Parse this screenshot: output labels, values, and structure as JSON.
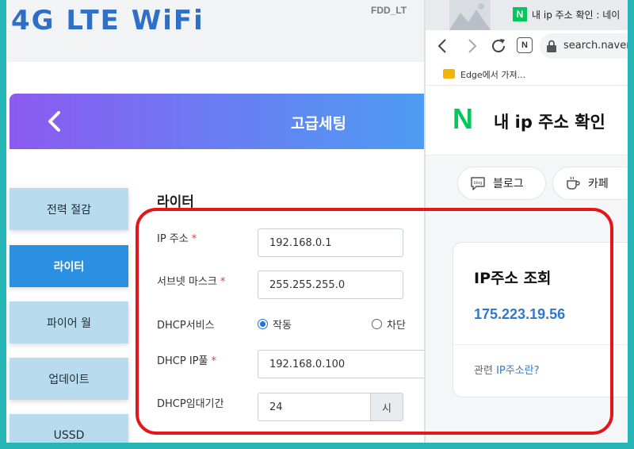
{
  "router": {
    "brand": "4G LTE WiFi",
    "model": "FDD_LT",
    "page_title": "고급세팅",
    "sidebar": {
      "items": [
        {
          "label": "전력 절감",
          "active": false
        },
        {
          "label": "라이터",
          "active": true
        },
        {
          "label": "파이어 월",
          "active": false
        },
        {
          "label": "업데이트",
          "active": false
        },
        {
          "label": "USSD",
          "active": false
        }
      ]
    },
    "section_title": "라이터",
    "fields": {
      "ip_label": "IP 주소",
      "ip_value": "192.168.0.1",
      "subnet_label": "서브넷 마스크",
      "subnet_value": "255.255.255.0",
      "dhcp_service_label": "DHCP서비스",
      "dhcp_on_label": "작동",
      "dhcp_off_label": "차단",
      "dhcp_pool_label": "DHCP IP풀",
      "dhcp_pool_value": "192.168.0.100",
      "lease_label": "DHCP임대기간",
      "lease_value": "24",
      "lease_unit": "시",
      "required_mark": "*"
    }
  },
  "browser": {
    "tab_favicon": "N",
    "tab_title": "내 ip 주소 확인 : 네이",
    "nav_reader_icon": "N",
    "url": "search.naver",
    "bookmark_label": "Edge에서 가져...",
    "naver_logo": "N",
    "search_query": "내 ip 주소 확인",
    "chips": [
      {
        "label": "블로그",
        "icon": "blog-icon"
      },
      {
        "label": "카페",
        "icon": "cafe-cup-icon"
      }
    ],
    "ip_card": {
      "title": "IP주소 조회",
      "ip": "175.223.19.56",
      "related_prefix": "관련 ",
      "related_link": "IP주소란?"
    }
  },
  "colors": {
    "outer_border": "#25b5b5",
    "highlight": "#e3161b",
    "sidebar_active": "#2b8fe2",
    "sidebar_item": "#b8dcee",
    "naver_green": "#03c75a",
    "ip_blue": "#2f78d1"
  }
}
